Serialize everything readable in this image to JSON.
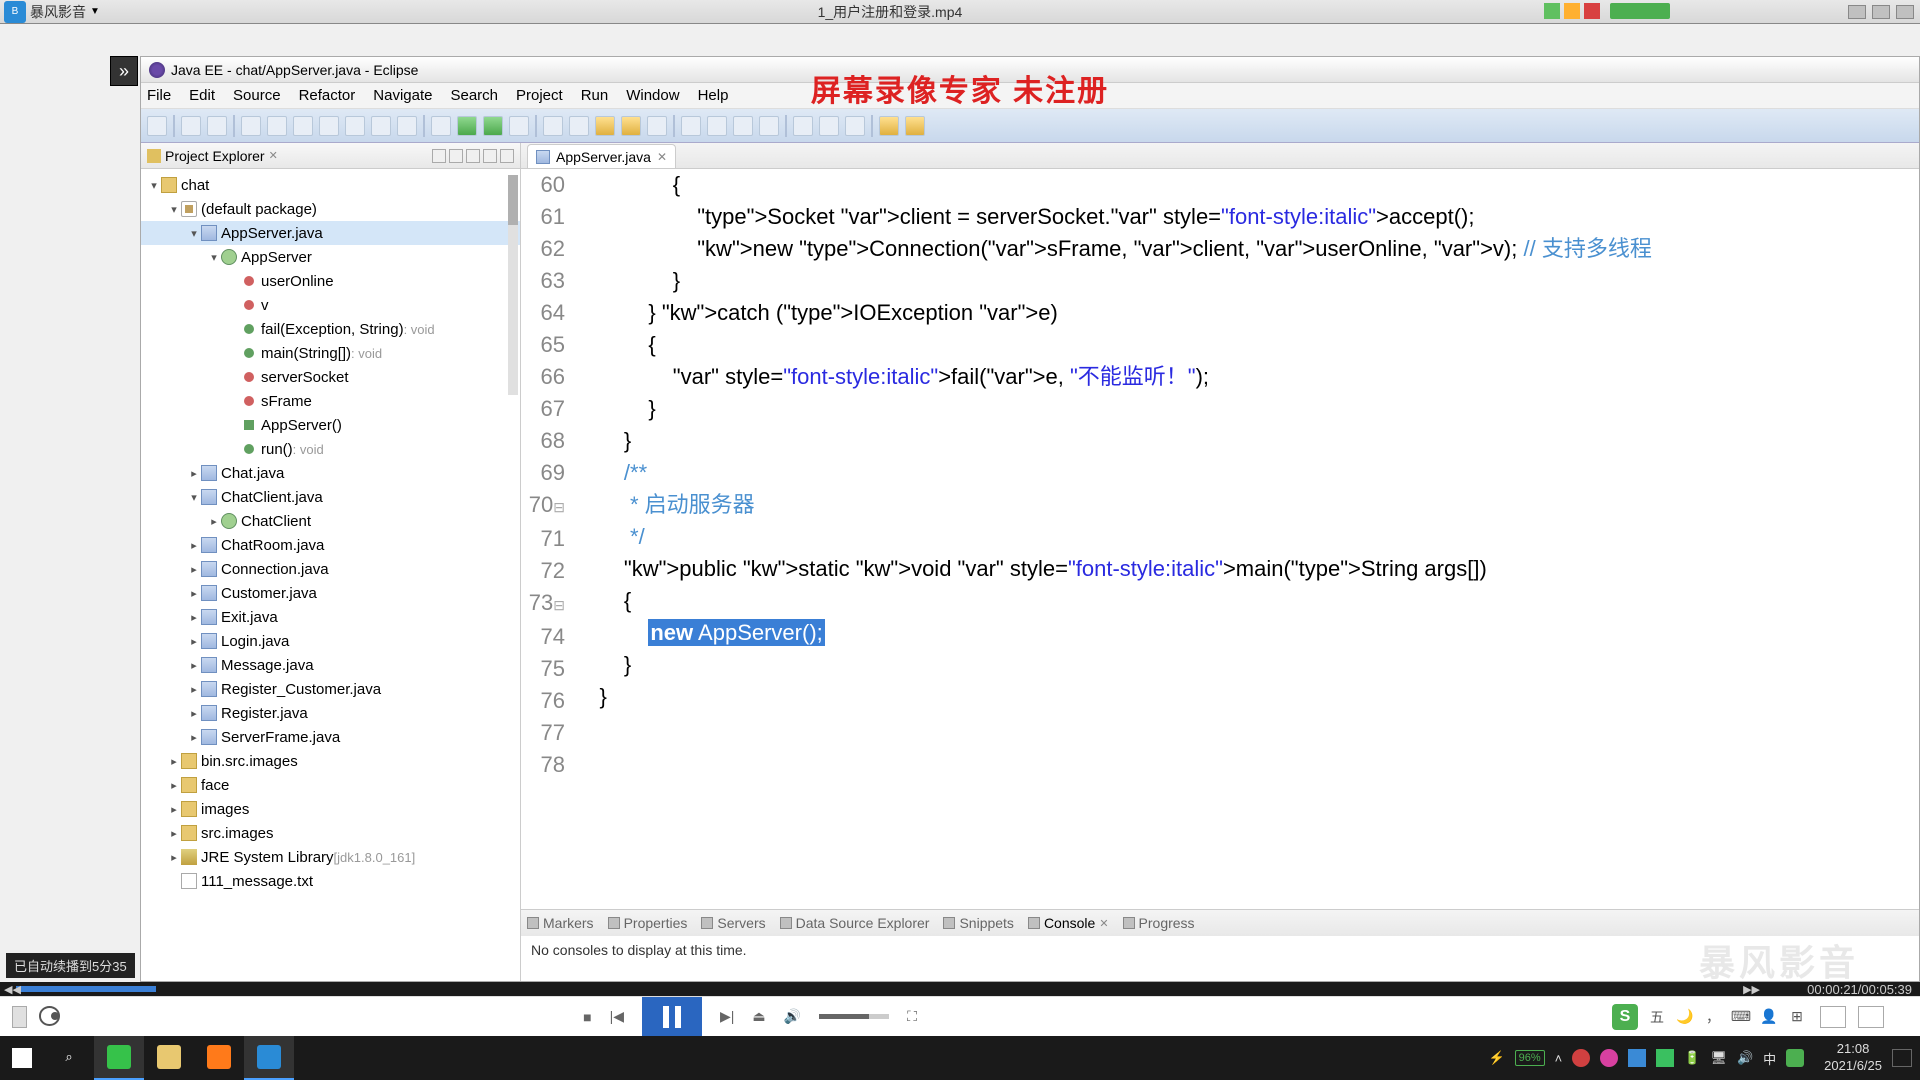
{
  "topbar": {
    "app": "暴风影音",
    "title": "1_用户注册和登录.mp4"
  },
  "overlay": "屏幕录像专家  未注册",
  "eclipse": {
    "title": "Java EE - chat/AppServer.java - Eclipse",
    "menu": [
      "File",
      "Edit",
      "Source",
      "Refactor",
      "Navigate",
      "Search",
      "Project",
      "Run",
      "Window",
      "Help"
    ],
    "projExp": {
      "title": "Project Explorer",
      "tree": {
        "project": "chat",
        "pkg": "(default package)",
        "file_sel": "AppServer.java",
        "class": "AppServer",
        "members": [
          {
            "k": "field",
            "n": "userOnline"
          },
          {
            "k": "field",
            "n": "v"
          },
          {
            "k": "method",
            "n": "fail(Exception, String)",
            "ret": ": void"
          },
          {
            "k": "method",
            "n": "main(String[])",
            "ret": ": void"
          },
          {
            "k": "field",
            "n": "serverSocket"
          },
          {
            "k": "field",
            "n": "sFrame"
          },
          {
            "k": "constr",
            "n": "AppServer()"
          },
          {
            "k": "method",
            "n": "run()",
            "ret": ": void"
          }
        ],
        "siblings": [
          "Chat.java",
          "ChatClient.java"
        ],
        "chatclient_child": "ChatClient",
        "siblings2": [
          "ChatRoom.java",
          "Connection.java",
          "Customer.java",
          "Exit.java",
          "Login.java",
          "Message.java",
          "Register_Customer.java",
          "Register.java",
          "ServerFrame.java"
        ],
        "folders": [
          "bin.src.images",
          "face",
          "images",
          "src.images"
        ],
        "lib": "JRE System Library",
        "lib_v": "[jdk1.8.0_161]",
        "txt": "111_message.txt"
      }
    },
    "editorTab": "AppServer.java",
    "lines": [
      {
        "n": 60,
        "t": "                {"
      },
      {
        "n": 61,
        "h": "                    Socket client = serverSocket.accept();"
      },
      {
        "n": 62,
        "h": "                    new Connection(sFrame, client, userOnline, v); // 支持多线程"
      },
      {
        "n": 63,
        "t": "                }"
      },
      {
        "n": 64,
        "h": "            } catch (IOException e)"
      },
      {
        "n": 65,
        "t": "            {"
      },
      {
        "n": 66,
        "h": "                fail(e, \"不能监听！\");"
      },
      {
        "n": 67,
        "t": "            }"
      },
      {
        "n": 68,
        "t": "        }"
      },
      {
        "n": 69,
        "t": ""
      },
      {
        "n": 70,
        "c": "        /**"
      },
      {
        "n": 71,
        "c": "         * 启动服务器"
      },
      {
        "n": 72,
        "c": "         */"
      },
      {
        "n": 73,
        "h": "        public static void main(String args[])"
      },
      {
        "n": 74,
        "t": "        {"
      },
      {
        "n": 75,
        "sel": "new AppServer();"
      },
      {
        "n": 76,
        "t": "        }"
      },
      {
        "n": 77,
        "t": "    }"
      },
      {
        "n": 78,
        "t": ""
      }
    ],
    "bottomTabs": [
      "Markers",
      "Properties",
      "Servers",
      "Data Source Explorer",
      "Snippets",
      "Console",
      "Progress"
    ],
    "consoleMsg": "No consoles to display at this time."
  },
  "autoTip": "已自动续播到5分35",
  "playback": {
    "time": "00:00:21/00:05:39"
  },
  "ime": {
    "label": "五"
  },
  "tray": {
    "batt": "96%",
    "ime2": "中",
    "time": "21:08",
    "date": "2021/6/25"
  }
}
